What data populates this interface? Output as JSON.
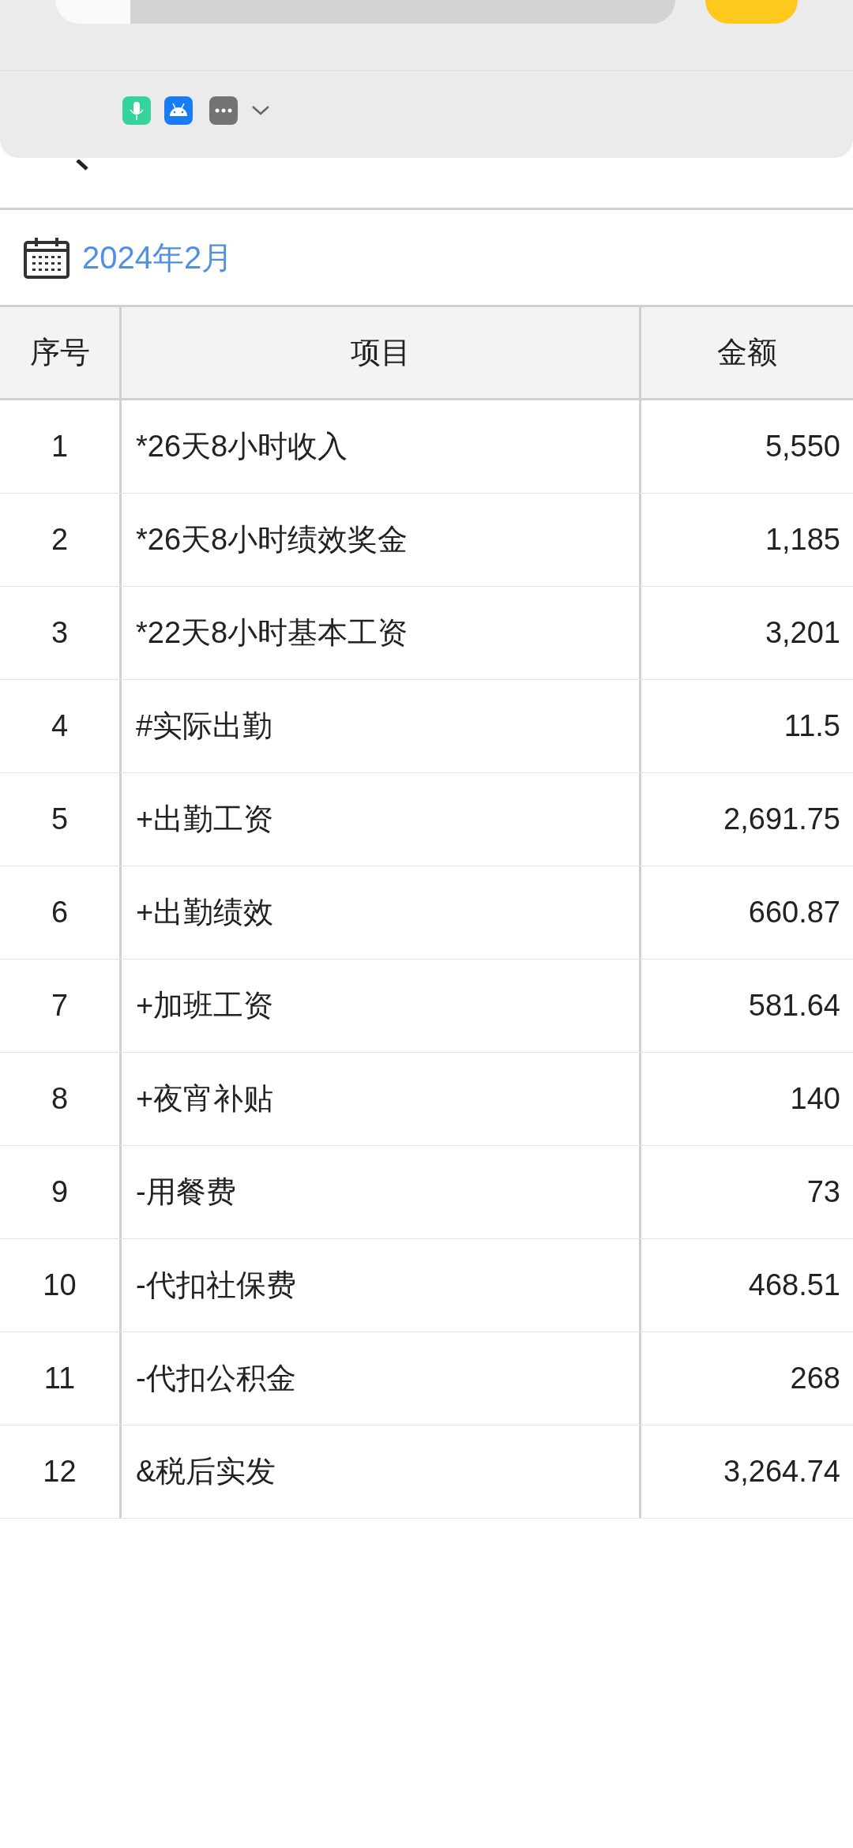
{
  "date_picker": {
    "value": "2024年2月"
  },
  "table": {
    "columns": [
      "序号",
      "项目",
      "金额"
    ],
    "rows": [
      [
        "1",
        "*26天8小时收入",
        "5,550"
      ],
      [
        "2",
        "*26天8小时绩效奖金",
        "1,185"
      ],
      [
        "3",
        "*22天8小时基本工资",
        "3,201"
      ],
      [
        "4",
        "#实际出勤",
        "11.5"
      ],
      [
        "5",
        "+出勤工资",
        "2,691.75"
      ],
      [
        "6",
        "+出勤绩效",
        "660.87"
      ],
      [
        "7",
        "+加班工资",
        "581.64"
      ],
      [
        "8",
        "+夜宵补贴",
        "140"
      ],
      [
        "9",
        "-用餐费",
        "73"
      ],
      [
        "10",
        "-代扣社保费",
        "468.51"
      ],
      [
        "11",
        "-代扣公积金",
        "268"
      ],
      [
        "12",
        "&税后实发",
        "3,264.74"
      ]
    ]
  }
}
